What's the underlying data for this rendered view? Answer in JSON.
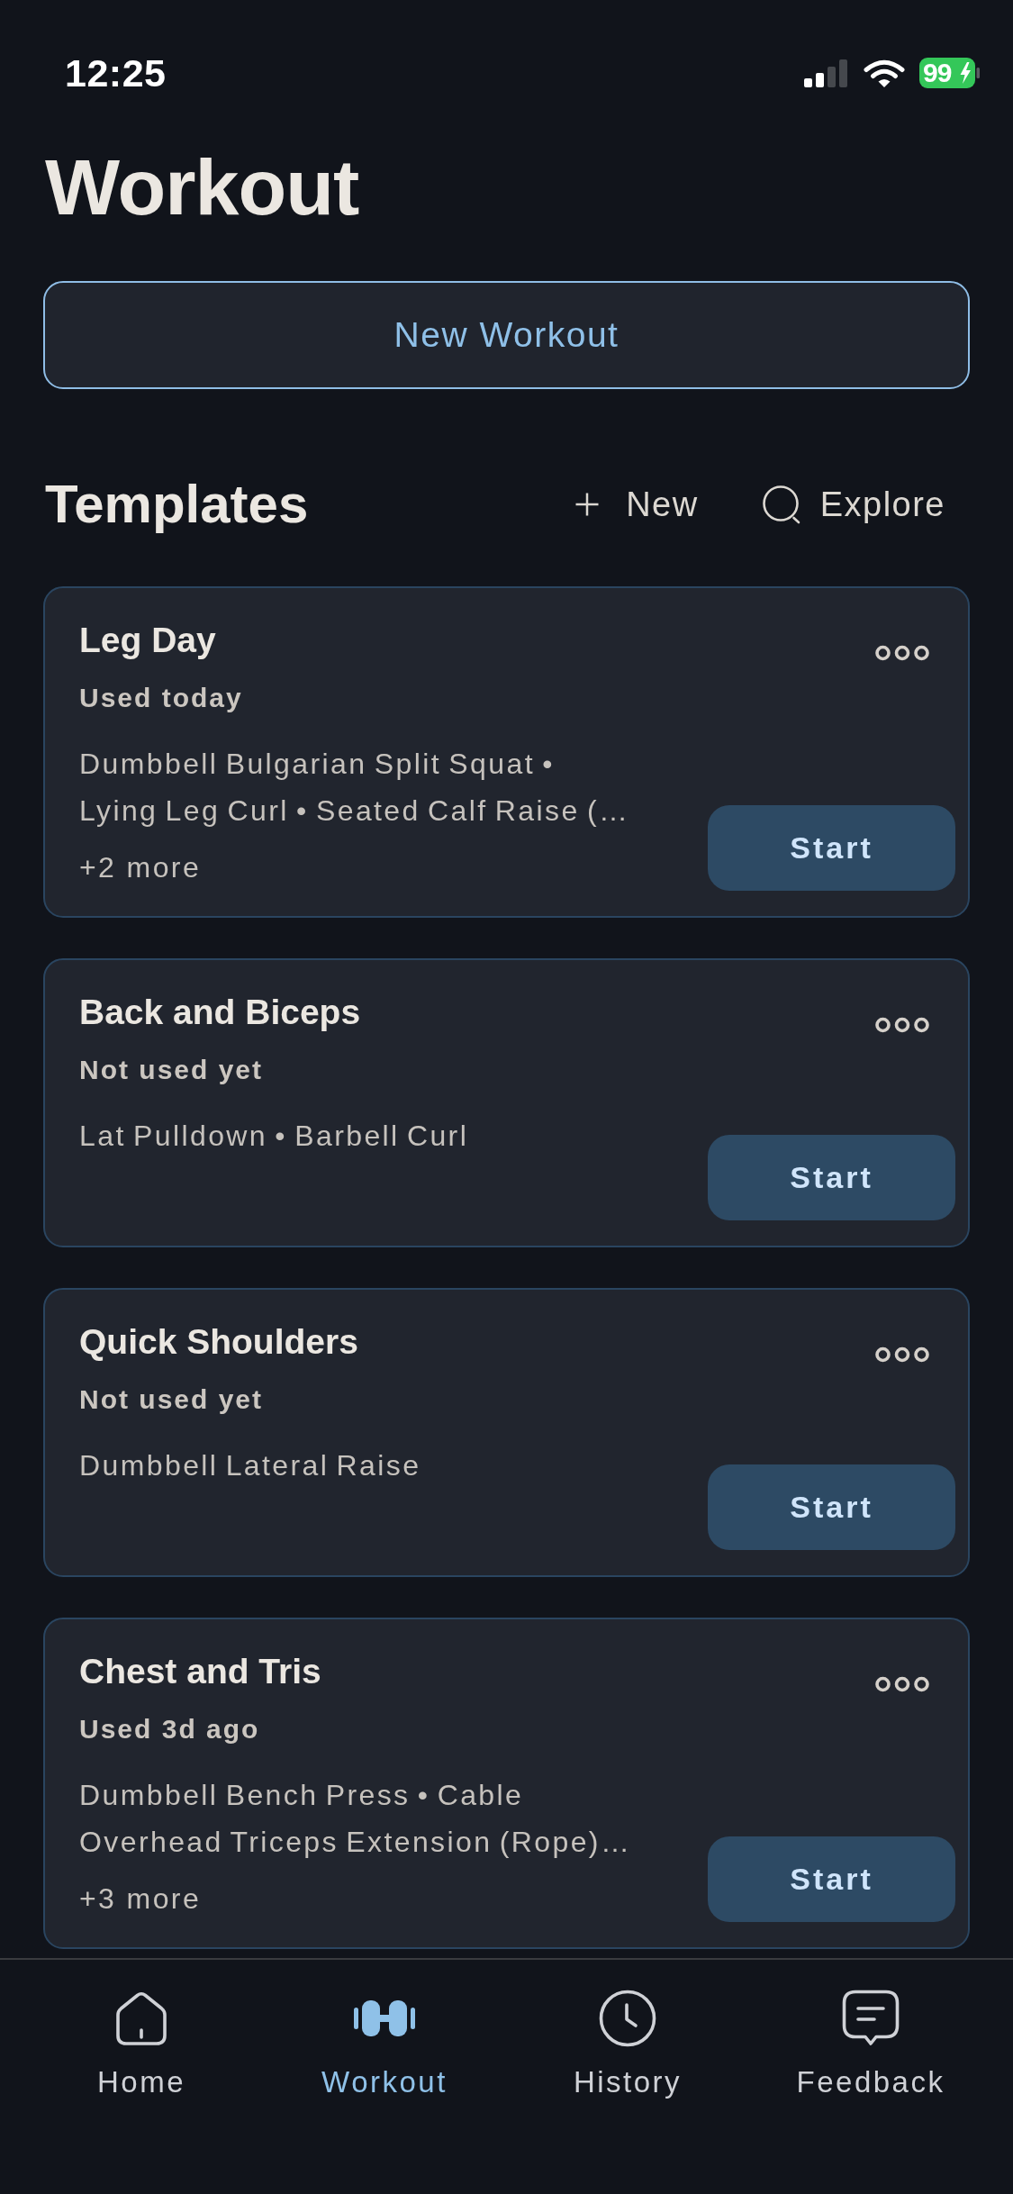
{
  "status_bar": {
    "time": "12:25",
    "battery": "99"
  },
  "title": "Workout",
  "new_workout_button": {
    "label": "New Workout"
  },
  "templates": {
    "title": "Templates",
    "actions": [
      {
        "kind": "new",
        "label": "New"
      },
      {
        "kind": "explore",
        "label": "Explore"
      }
    ],
    "cards": [
      {
        "name": "Leg Day",
        "last_used": "Used today",
        "exercises": "Dumbbell Bulgarian Split Squat • Lying Leg Curl • Seated Calf Raise (…",
        "more": "+2 more",
        "button": "Start"
      },
      {
        "name": "Back and Biceps",
        "last_used": "Not used yet",
        "exercises": "Lat Pulldown • Barbell Curl",
        "button": "Start"
      },
      {
        "name": "Quick Shoulders",
        "last_used": "Not used yet",
        "exercises": "Dumbbell Lateral Raise",
        "button": "Start"
      },
      {
        "name": "Chest and Tris",
        "last_used": "Used 3d ago",
        "exercises": "Dumbbell Bench Press • Cable Overhead Triceps Extension (Rope)…",
        "more": "+3 more",
        "button": "Start"
      }
    ]
  },
  "tab_bar": [
    {
      "kind": "home",
      "label": "Home",
      "selected": false
    },
    {
      "kind": "workout",
      "label": "Workout",
      "selected": true
    },
    {
      "kind": "history",
      "label": "History",
      "selected": false
    },
    {
      "kind": "feedback",
      "label": "Feedback",
      "selected": false
    }
  ]
}
